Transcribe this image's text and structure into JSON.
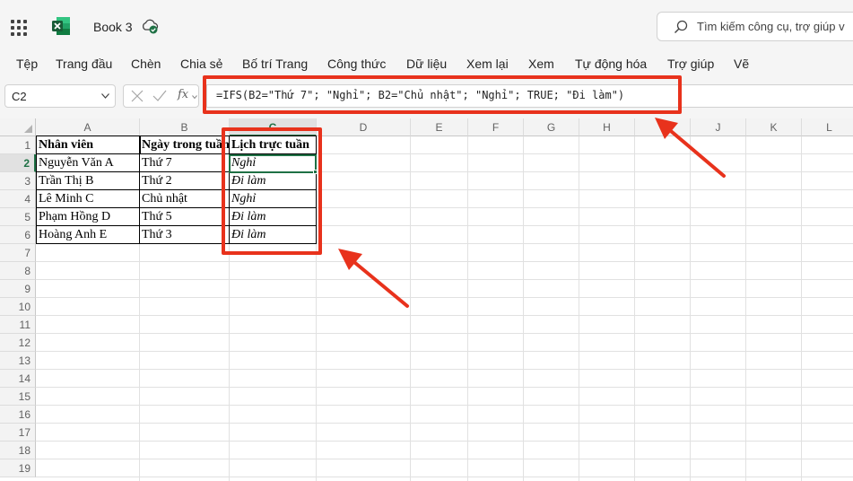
{
  "app": {
    "title": "Book 3",
    "search_placeholder": "Tìm kiếm công cụ, trợ giúp v",
    "accent": "#1f7145",
    "annotation_color": "#e8321c"
  },
  "menu": [
    "Tệp",
    "Trang đầu",
    "Chèn",
    "Chia sẻ",
    "Bố trí Trang",
    "Công thức",
    "Dữ liệu",
    "Xem lại",
    "Xem",
    "Tự động hóa",
    "Trợ giúp",
    "Vẽ"
  ],
  "formula_bar": {
    "name_box": "C2",
    "fx": "fx",
    "formula": "=IFS(B2=\"Thứ 7\"; \"Nghỉ\"; B2=\"Chủ nhật\"; \"Nghỉ\"; TRUE; \"Đi làm\")"
  },
  "columns": [
    "A",
    "B",
    "C",
    "D",
    "E",
    "F",
    "G",
    "H",
    "I",
    "J",
    "K",
    "L"
  ],
  "rows": [
    "1",
    "2",
    "3",
    "4",
    "5",
    "6",
    "7",
    "8",
    "9",
    "10",
    "11",
    "12",
    "13",
    "14",
    "15",
    "16",
    "17",
    "18",
    "19"
  ],
  "selected_cell": "C2",
  "table": {
    "headers": [
      "Nhân viên",
      "Ngày trong tuần",
      "Lịch trực tuần"
    ],
    "rows": [
      [
        "Nguyễn Văn A",
        "Thứ 7",
        "Nghỉ"
      ],
      [
        "Trần Thị B",
        "Thứ 2",
        "Đi làm"
      ],
      [
        "Lê Minh C",
        "Chủ nhật",
        "Nghỉ"
      ],
      [
        "Phạm Hồng D",
        "Thứ 5",
        "Đi làm"
      ],
      [
        "Hoàng Anh E",
        "Thứ 3",
        "Đi làm"
      ]
    ]
  }
}
